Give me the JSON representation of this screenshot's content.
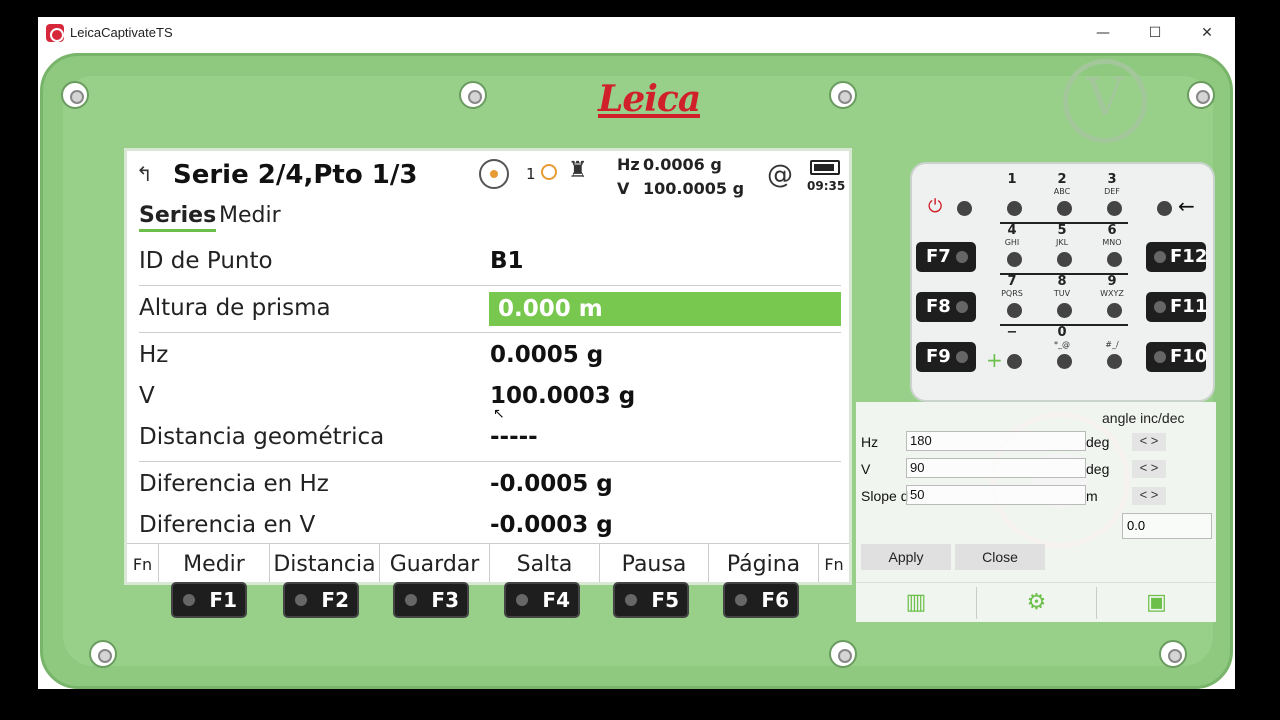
{
  "window": {
    "title": "LeicaCaptivateTS",
    "minimize": "—",
    "maximize": "☐",
    "close": "✕"
  },
  "device": {
    "brand": "Leica"
  },
  "screen": {
    "title": "Serie 2/4,Pto 1/3",
    "status": {
      "face": "1",
      "hz_label": "Hz",
      "hz_value": "0.0006 g",
      "v_label": "V",
      "v_value": "100.0005 g",
      "at": "@",
      "time": "09:35"
    },
    "tabs": [
      {
        "label": "Series"
      },
      {
        "label": "Medir"
      }
    ],
    "rows": [
      {
        "label": "ID de Punto",
        "value": "B1"
      },
      {
        "label": "Altura de prisma",
        "value": "0.000 m"
      },
      {
        "label": "Hz",
        "value": "0.0005 g"
      },
      {
        "label": "V",
        "value": "100.0003 g"
      },
      {
        "label": "Distancia geométrica",
        "value": "-----"
      },
      {
        "label": "Diferencia en Hz",
        "value": "-0.0005 g"
      },
      {
        "label": "Diferencia en V",
        "value": "-0.0003 g"
      }
    ],
    "softkeys": [
      "Fn",
      "Medir",
      "Distancia",
      "Guardar",
      "Salta",
      "Pausa",
      "Página",
      "Fn"
    ]
  },
  "fkeys": [
    "F1",
    "F2",
    "F3",
    "F4",
    "F5",
    "F6"
  ],
  "side_fkeys": [
    "F7",
    "F8",
    "F9",
    "F12",
    "F11",
    "F10"
  ],
  "keypad": {
    "digits": [
      "1",
      "2",
      "3",
      "4",
      "5",
      "6",
      "7",
      "8",
      "9",
      "−",
      "0",
      "#"
    ],
    "subs": [
      "",
      "ABC",
      "DEF",
      "GHI",
      "JKL",
      "MNO",
      "PQRS",
      "TUV",
      "WXYZ",
      "",
      "*_@",
      "#_/"
    ]
  },
  "control_panel": {
    "heading": "angle inc/dec",
    "rows": [
      {
        "label": "Hz",
        "value": "180",
        "unit": "deg",
        "arrows": "< >"
      },
      {
        "label": "V",
        "value": "90",
        "unit": "deg",
        "arrows": "< >"
      },
      {
        "label": "Slope d",
        "value": "50",
        "unit": "m",
        "arrows": "< >"
      }
    ],
    "step": "0.0",
    "apply": "Apply",
    "close": "Close"
  },
  "colors": {
    "accent": "#78c84f",
    "device": "#8ec97f",
    "brand": "#d0202a"
  }
}
